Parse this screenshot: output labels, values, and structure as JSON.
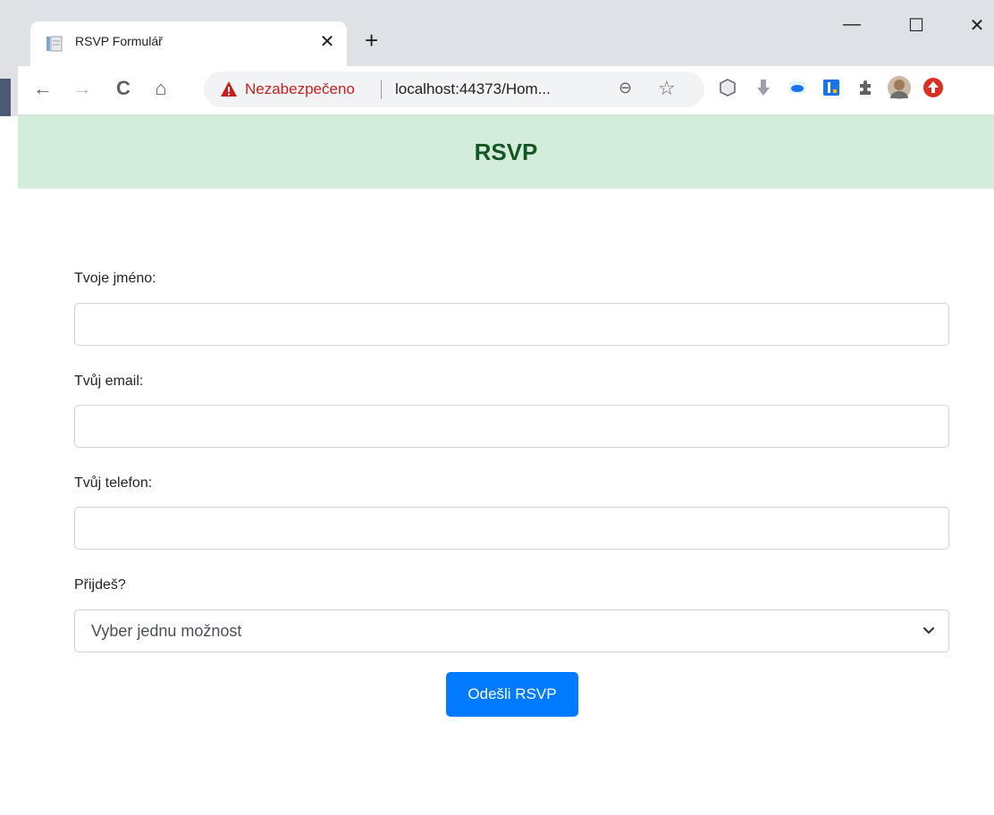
{
  "browser": {
    "tab_title": "RSVP Formulář",
    "new_tab": "+",
    "security_label": "Nezabezpečeno",
    "url": "localhost:44373/Hom...",
    "window_controls": {
      "minimize": "—",
      "maximize": "☐",
      "close": "✕"
    }
  },
  "icons": {
    "back": "←",
    "forward": "→",
    "reload": "C",
    "home": "⌂",
    "zoom": "⊖",
    "bookmark": "☆",
    "tab_close": "✕"
  },
  "page": {
    "header_title": "RSVP",
    "fields": [
      {
        "label": "Tvoje jméno:",
        "value": ""
      },
      {
        "label": "Tvůj email:",
        "value": ""
      },
      {
        "label": "Tvůj telefon:",
        "value": ""
      }
    ],
    "attend": {
      "label": "Přijdeš?",
      "selected": "Vyber jednu možnost"
    },
    "submit_label": "Odešli RSVP"
  },
  "colors": {
    "header_bg": "#d4edda",
    "header_text": "#155724",
    "primary_button": "#007bff",
    "warning": "#c5221f"
  }
}
